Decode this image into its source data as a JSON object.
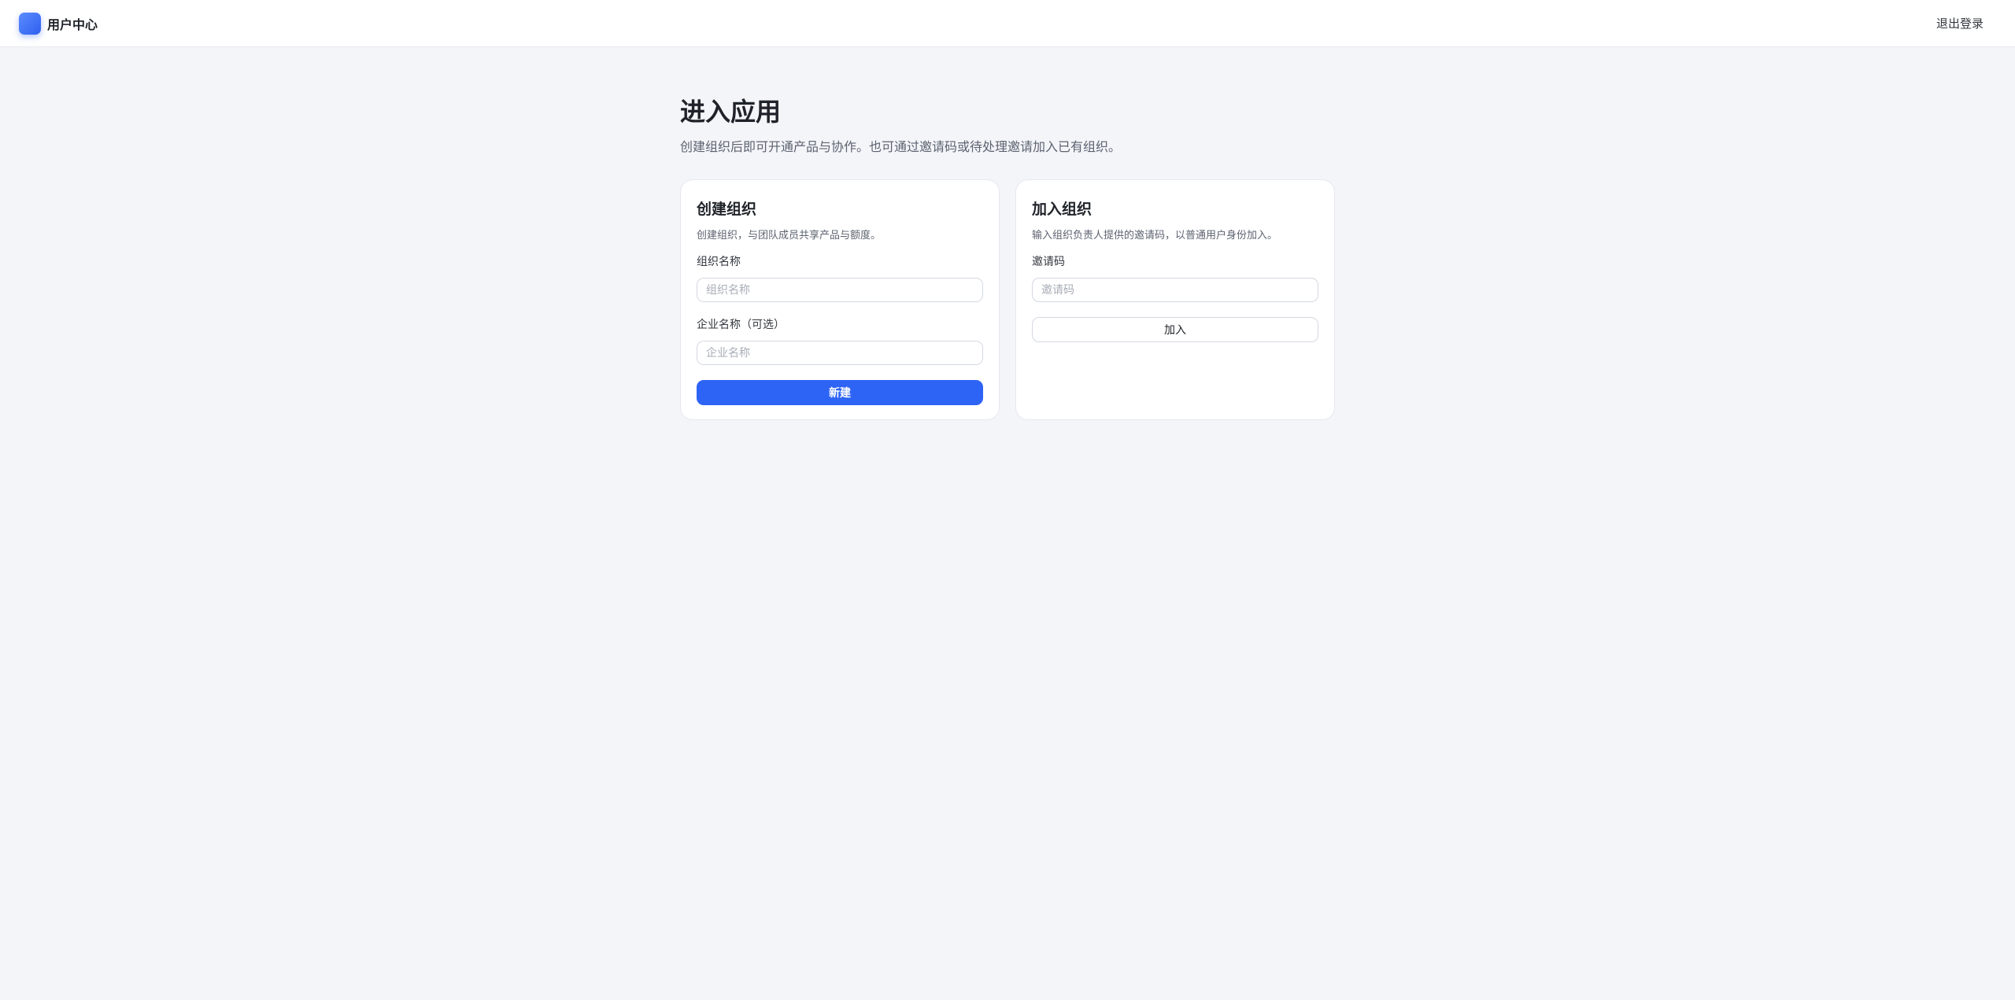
{
  "header": {
    "app_name": "用户中心",
    "logout_label": "退出登录"
  },
  "main": {
    "title": "进入应用",
    "subtitle": "创建组织后即可开通产品与协作。也可通过邀请码或待处理邀请加入已有组织。"
  },
  "create_card": {
    "title": "创建组织",
    "description": "创建组织，与团队成员共享产品与额度。",
    "org_name_label": "组织名称",
    "org_name_placeholder": "组织名称",
    "org_name_value": "",
    "company_name_label": "企业名称（可选）",
    "company_name_placeholder": "企业名称",
    "company_name_value": "",
    "submit_label": "新建"
  },
  "join_card": {
    "title": "加入组织",
    "description": "输入组织负责人提供的邀请码，以普通用户身份加入。",
    "invite_code_label": "邀请码",
    "invite_code_placeholder": "邀请码",
    "invite_code_value": "",
    "submit_label": "加入"
  },
  "colors": {
    "primary": "#2e64f5",
    "background": "#f4f5f9",
    "card": "#ffffff"
  }
}
